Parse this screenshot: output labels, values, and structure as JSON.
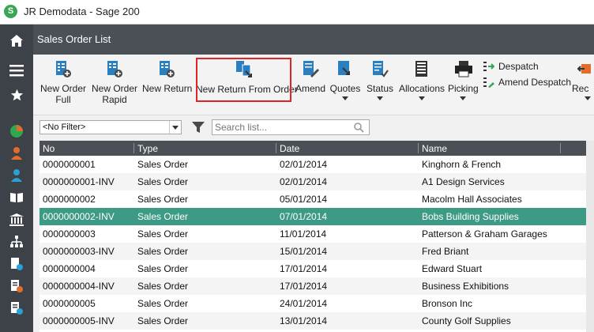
{
  "window": {
    "title": "JR Demodata - Sage 200",
    "logo_letter": "S"
  },
  "header": {
    "title": "Sales Order List"
  },
  "toolbar": {
    "buttons": [
      {
        "label": "New Order\nFull",
        "icon": "new-order-icon"
      },
      {
        "label": "New Order\nRapid",
        "icon": "new-order-rapid-icon"
      },
      {
        "label": "New Return",
        "icon": "new-return-icon"
      },
      {
        "label": "New Return From Order",
        "icon": "return-from-order-icon"
      },
      {
        "label": "Amend",
        "icon": "amend-icon"
      },
      {
        "label": "Quotes",
        "icon": "quotes-icon"
      },
      {
        "label": "Status",
        "icon": "status-icon"
      },
      {
        "label": "Allocations",
        "icon": "allocations-icon"
      },
      {
        "label": "Picking",
        "icon": "printer-icon"
      },
      {
        "label": "Rec",
        "icon": "receipt-icon"
      }
    ],
    "despatch_label": "Despatch",
    "amend_despatch_label": "Amend Despatch"
  },
  "filter": {
    "selected": "<No Filter>",
    "search_placeholder": "Search list..."
  },
  "grid": {
    "columns": [
      "No",
      "Type",
      "Date",
      "Name"
    ],
    "rows": [
      [
        "0000000001",
        "Sales Order",
        "02/01/2014",
        "Kinghorn & French"
      ],
      [
        "0000000001-INV",
        "Sales Order",
        "02/01/2014",
        "A1 Design Services"
      ],
      [
        "0000000002",
        "Sales Order",
        "05/01/2014",
        "Macolm Hall Associates"
      ],
      [
        "0000000002-INV",
        "Sales Order",
        "07/01/2014",
        "Bobs Building Supplies"
      ],
      [
        "0000000003",
        "Sales Order",
        "11/01/2014",
        "Patterson & Graham Garages"
      ],
      [
        "0000000003-INV",
        "Sales Order",
        "15/01/2014",
        "Fred Briant"
      ],
      [
        "0000000004",
        "Sales Order",
        "17/01/2014",
        "Edward Stuart"
      ],
      [
        "0000000004-INV",
        "Sales Order",
        "17/01/2014",
        "Business Exhibitions"
      ],
      [
        "0000000005",
        "Sales Order",
        "24/01/2014",
        "Bronson Inc"
      ],
      [
        "0000000005-INV",
        "Sales Order",
        "13/01/2014",
        "County Golf Supplies"
      ]
    ],
    "selected_row": 3
  },
  "colors": {
    "selected_row": "#3d9b85",
    "header_bg": "#4a5056",
    "sidebar_bg": "#3d4248",
    "highlight_border": "#e0242a"
  }
}
